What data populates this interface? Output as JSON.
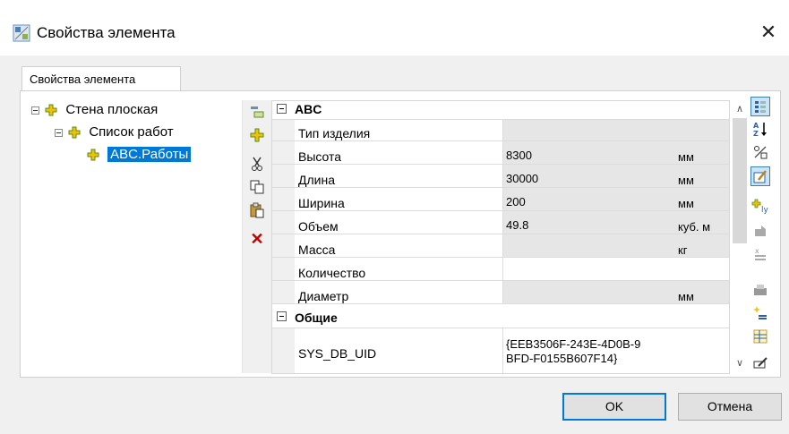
{
  "window": {
    "title": "Свойства элемента",
    "close_glyph": "✕"
  },
  "tab": {
    "label": "Свойства элемента"
  },
  "tree": {
    "nodes": [
      {
        "label": "Стена плоская",
        "expanded": true,
        "level": 0
      },
      {
        "label": "Список работ",
        "expanded": true,
        "level": 1
      },
      {
        "label": "ABC.Работы",
        "selected": true,
        "level": 2
      }
    ]
  },
  "left_toolbar": {
    "buttons": [
      "add-child-icon",
      "add-element-icon",
      "cut-icon",
      "copy-icon",
      "paste-icon",
      "delete-icon"
    ]
  },
  "grid": {
    "categories": [
      {
        "label": "ABC",
        "rows": [
          {
            "name": "Тип изделия",
            "value": "",
            "unit": ""
          },
          {
            "name": "Высота",
            "value": "8300",
            "unit": "мм"
          },
          {
            "name": "Длина",
            "value": "30000",
            "unit": "мм"
          },
          {
            "name": "Ширина",
            "value": "200",
            "unit": "мм"
          },
          {
            "name": "Объем",
            "value": "49.8",
            "unit": "куб. м"
          },
          {
            "name": "Масса",
            "value": "",
            "unit": "кг"
          },
          {
            "name": "Количество",
            "value": "",
            "unit": ""
          },
          {
            "name": "Диаметр",
            "value": "",
            "unit": "мм"
          }
        ]
      },
      {
        "label": "Общие",
        "rows": [
          {
            "name": "SYS_DB_UID",
            "value_line1": "{EEB3506F-243E-4D0B-9",
            "value_line2": "BFD-F0155B607F14}",
            "unit": ""
          }
        ]
      }
    ]
  },
  "right_toolbar": {
    "buttons": [
      "categorized-icon",
      "sort-az-icon",
      "percent-icon",
      "edit-property-icon",
      "add-property-icon",
      "property-icon",
      "remove-property-icon",
      "print-icon",
      "new-property-icon",
      "table-icon",
      "edit-notes-icon"
    ]
  },
  "buttons": {
    "ok": "OK",
    "cancel": "Отмена"
  },
  "colors": {
    "selection": "#0078d7",
    "accent_border": "#0078d7"
  }
}
